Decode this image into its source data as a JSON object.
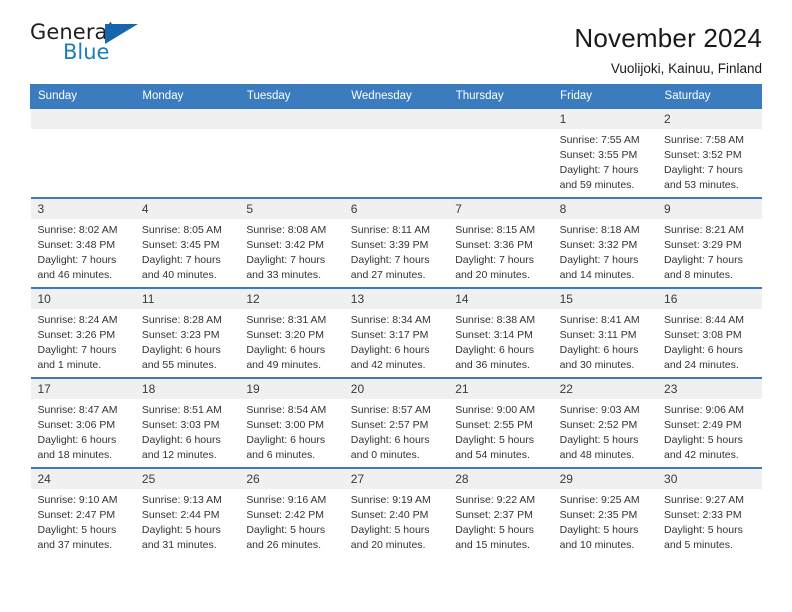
{
  "logo": {
    "word_general": "General",
    "word_blue": "Blue",
    "triangle": "triangle-icon",
    "accent_color": "#1a7fc1"
  },
  "header": {
    "title": "November 2024",
    "subtitle": "Vuolijoki, Kainuu, Finland",
    "header_bg_color": "#3b7cbf",
    "band_bg_color": "#f0f0f0"
  },
  "weekday_headers": [
    "Sunday",
    "Monday",
    "Tuesday",
    "Wednesday",
    "Thursday",
    "Friday",
    "Saturday"
  ],
  "labels": {
    "sunrise": "Sunrise:",
    "sunset": "Sunset:",
    "daylight": "Daylight:"
  },
  "weeks": [
    [
      {
        "day": "",
        "empty": true
      },
      {
        "day": "",
        "empty": true
      },
      {
        "day": "",
        "empty": true
      },
      {
        "day": "",
        "empty": true
      },
      {
        "day": "",
        "empty": true
      },
      {
        "day": "1",
        "sunrise": "Sunrise: 7:55 AM",
        "sunset": "Sunset: 3:55 PM",
        "daylight1": "Daylight: 7 hours",
        "daylight2": "and 59 minutes."
      },
      {
        "day": "2",
        "sunrise": "Sunrise: 7:58 AM",
        "sunset": "Sunset: 3:52 PM",
        "daylight1": "Daylight: 7 hours",
        "daylight2": "and 53 minutes."
      }
    ],
    [
      {
        "day": "3",
        "sunrise": "Sunrise: 8:02 AM",
        "sunset": "Sunset: 3:48 PM",
        "daylight1": "Daylight: 7 hours",
        "daylight2": "and 46 minutes."
      },
      {
        "day": "4",
        "sunrise": "Sunrise: 8:05 AM",
        "sunset": "Sunset: 3:45 PM",
        "daylight1": "Daylight: 7 hours",
        "daylight2": "and 40 minutes."
      },
      {
        "day": "5",
        "sunrise": "Sunrise: 8:08 AM",
        "sunset": "Sunset: 3:42 PM",
        "daylight1": "Daylight: 7 hours",
        "daylight2": "and 33 minutes."
      },
      {
        "day": "6",
        "sunrise": "Sunrise: 8:11 AM",
        "sunset": "Sunset: 3:39 PM",
        "daylight1": "Daylight: 7 hours",
        "daylight2": "and 27 minutes."
      },
      {
        "day": "7",
        "sunrise": "Sunrise: 8:15 AM",
        "sunset": "Sunset: 3:36 PM",
        "daylight1": "Daylight: 7 hours",
        "daylight2": "and 20 minutes."
      },
      {
        "day": "8",
        "sunrise": "Sunrise: 8:18 AM",
        "sunset": "Sunset: 3:32 PM",
        "daylight1": "Daylight: 7 hours",
        "daylight2": "and 14 minutes."
      },
      {
        "day": "9",
        "sunrise": "Sunrise: 8:21 AM",
        "sunset": "Sunset: 3:29 PM",
        "daylight1": "Daylight: 7 hours",
        "daylight2": "and 8 minutes."
      }
    ],
    [
      {
        "day": "10",
        "sunrise": "Sunrise: 8:24 AM",
        "sunset": "Sunset: 3:26 PM",
        "daylight1": "Daylight: 7 hours",
        "daylight2": "and 1 minute."
      },
      {
        "day": "11",
        "sunrise": "Sunrise: 8:28 AM",
        "sunset": "Sunset: 3:23 PM",
        "daylight1": "Daylight: 6 hours",
        "daylight2": "and 55 minutes."
      },
      {
        "day": "12",
        "sunrise": "Sunrise: 8:31 AM",
        "sunset": "Sunset: 3:20 PM",
        "daylight1": "Daylight: 6 hours",
        "daylight2": "and 49 minutes."
      },
      {
        "day": "13",
        "sunrise": "Sunrise: 8:34 AM",
        "sunset": "Sunset: 3:17 PM",
        "daylight1": "Daylight: 6 hours",
        "daylight2": "and 42 minutes."
      },
      {
        "day": "14",
        "sunrise": "Sunrise: 8:38 AM",
        "sunset": "Sunset: 3:14 PM",
        "daylight1": "Daylight: 6 hours",
        "daylight2": "and 36 minutes."
      },
      {
        "day": "15",
        "sunrise": "Sunrise: 8:41 AM",
        "sunset": "Sunset: 3:11 PM",
        "daylight1": "Daylight: 6 hours",
        "daylight2": "and 30 minutes."
      },
      {
        "day": "16",
        "sunrise": "Sunrise: 8:44 AM",
        "sunset": "Sunset: 3:08 PM",
        "daylight1": "Daylight: 6 hours",
        "daylight2": "and 24 minutes."
      }
    ],
    [
      {
        "day": "17",
        "sunrise": "Sunrise: 8:47 AM",
        "sunset": "Sunset: 3:06 PM",
        "daylight1": "Daylight: 6 hours",
        "daylight2": "and 18 minutes."
      },
      {
        "day": "18",
        "sunrise": "Sunrise: 8:51 AM",
        "sunset": "Sunset: 3:03 PM",
        "daylight1": "Daylight: 6 hours",
        "daylight2": "and 12 minutes."
      },
      {
        "day": "19",
        "sunrise": "Sunrise: 8:54 AM",
        "sunset": "Sunset: 3:00 PM",
        "daylight1": "Daylight: 6 hours",
        "daylight2": "and 6 minutes."
      },
      {
        "day": "20",
        "sunrise": "Sunrise: 8:57 AM",
        "sunset": "Sunset: 2:57 PM",
        "daylight1": "Daylight: 6 hours",
        "daylight2": "and 0 minutes."
      },
      {
        "day": "21",
        "sunrise": "Sunrise: 9:00 AM",
        "sunset": "Sunset: 2:55 PM",
        "daylight1": "Daylight: 5 hours",
        "daylight2": "and 54 minutes."
      },
      {
        "day": "22",
        "sunrise": "Sunrise: 9:03 AM",
        "sunset": "Sunset: 2:52 PM",
        "daylight1": "Daylight: 5 hours",
        "daylight2": "and 48 minutes."
      },
      {
        "day": "23",
        "sunrise": "Sunrise: 9:06 AM",
        "sunset": "Sunset: 2:49 PM",
        "daylight1": "Daylight: 5 hours",
        "daylight2": "and 42 minutes."
      }
    ],
    [
      {
        "day": "24",
        "sunrise": "Sunrise: 9:10 AM",
        "sunset": "Sunset: 2:47 PM",
        "daylight1": "Daylight: 5 hours",
        "daylight2": "and 37 minutes."
      },
      {
        "day": "25",
        "sunrise": "Sunrise: 9:13 AM",
        "sunset": "Sunset: 2:44 PM",
        "daylight1": "Daylight: 5 hours",
        "daylight2": "and 31 minutes."
      },
      {
        "day": "26",
        "sunrise": "Sunrise: 9:16 AM",
        "sunset": "Sunset: 2:42 PM",
        "daylight1": "Daylight: 5 hours",
        "daylight2": "and 26 minutes."
      },
      {
        "day": "27",
        "sunrise": "Sunrise: 9:19 AM",
        "sunset": "Sunset: 2:40 PM",
        "daylight1": "Daylight: 5 hours",
        "daylight2": "and 20 minutes."
      },
      {
        "day": "28",
        "sunrise": "Sunrise: 9:22 AM",
        "sunset": "Sunset: 2:37 PM",
        "daylight1": "Daylight: 5 hours",
        "daylight2": "and 15 minutes."
      },
      {
        "day": "29",
        "sunrise": "Sunrise: 9:25 AM",
        "sunset": "Sunset: 2:35 PM",
        "daylight1": "Daylight: 5 hours",
        "daylight2": "and 10 minutes."
      },
      {
        "day": "30",
        "sunrise": "Sunrise: 9:27 AM",
        "sunset": "Sunset: 2:33 PM",
        "daylight1": "Daylight: 5 hours",
        "daylight2": "and 5 minutes."
      }
    ]
  ]
}
